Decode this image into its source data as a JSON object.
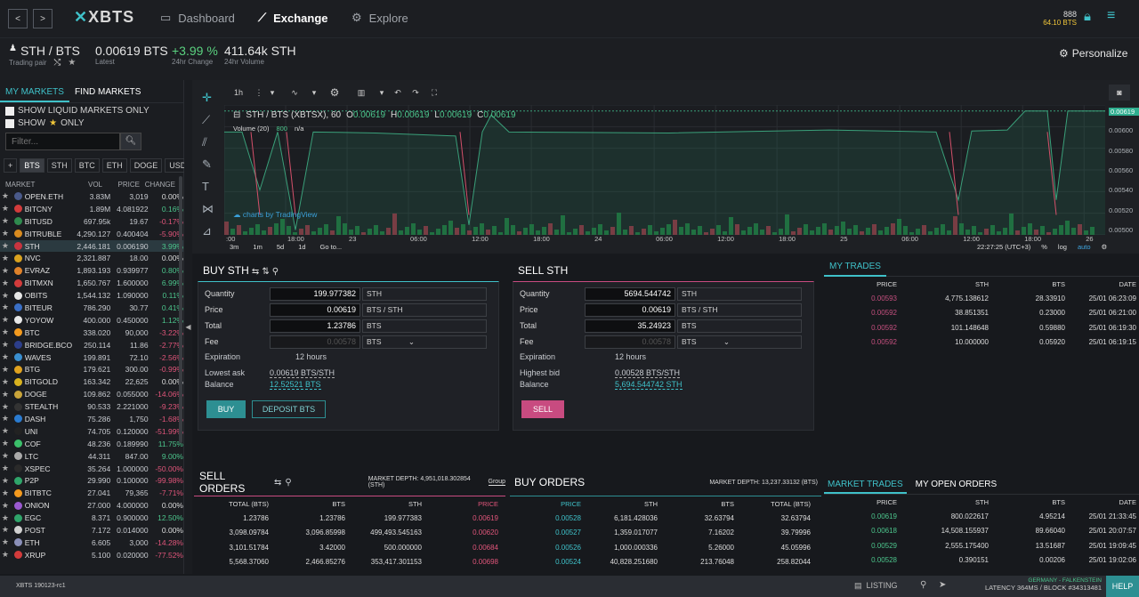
{
  "topbar": {
    "back": "<",
    "forward": ">",
    "logo": "XBTS",
    "nav": [
      {
        "label": "Dashboard",
        "icon": "dashboard-icon"
      },
      {
        "label": "Exchange",
        "icon": "exchange-icon"
      },
      {
        "label": "Explore",
        "icon": "explore-icon"
      }
    ],
    "account_number": "888",
    "account_balance": "64.10 BTS"
  },
  "pairbar": {
    "pair": "STH / BTS",
    "pair_sub": "Trading pair",
    "latest": "0.00619 BTS",
    "latest_sub": "Latest",
    "change": "+3.99 %",
    "change_sub": "24hr Change",
    "volume": "411.64k STH",
    "volume_sub": "24hr Volume",
    "personalize": "Personalize"
  },
  "markets": {
    "tabs": [
      "MY MARKETS",
      "FIND MARKETS"
    ],
    "liquid_label": "SHOW LIQUID MARKETS ONLY",
    "show_label": "SHOW",
    "only_label": "ONLY",
    "filter_placeholder": "Filter...",
    "currency_tabs": [
      "+",
      "BTS",
      "STH",
      "BTC",
      "ETH",
      "DOGE",
      "USD"
    ],
    "columns": [
      "MARKET",
      "VOL",
      "PRICE",
      "CHANGE"
    ],
    "rows": [
      {
        "name": "OPEN.ETH",
        "vol": "3.83M",
        "price": "3,019",
        "change": "0.00%",
        "c": "neu",
        "ic": "#4a5a8a"
      },
      {
        "name": "BITCNY",
        "vol": "1.89M",
        "price": "4.081922",
        "change": "0.16%",
        "c": "pos",
        "ic": "#d23b3b"
      },
      {
        "name": "BITUSD",
        "vol": "697.95k",
        "price": "19.67",
        "change": "-0.17%",
        "c": "neg",
        "ic": "#2f8a4e"
      },
      {
        "name": "BITRUBLE",
        "vol": "4,290.127",
        "price": "0.400404",
        "change": "-5.90%",
        "c": "neg",
        "ic": "#d98b1f"
      },
      {
        "name": "STH",
        "vol": "2,446.181",
        "price": "0.006190",
        "change": "3.99%",
        "c": "pos",
        "ic": "#c8343f"
      },
      {
        "name": "NVC",
        "vol": "2,321.887",
        "price": "18.00",
        "change": "0.00%",
        "c": "neu",
        "ic": "#d9a21f"
      },
      {
        "name": "EVRAZ",
        "vol": "1,893.193",
        "price": "0.939977",
        "change": "0.80%",
        "c": "pos",
        "ic": "#e0822a"
      },
      {
        "name": "BITMXN",
        "vol": "1,650.767",
        "price": "1.600000",
        "change": "6.99%",
        "c": "pos",
        "ic": "#d23b3b"
      },
      {
        "name": "OBITS",
        "vol": "1,544.132",
        "price": "1.090000",
        "change": "0.11%",
        "c": "pos",
        "ic": "#e6e6e6"
      },
      {
        "name": "BITEUR",
        "vol": "786.290",
        "price": "30.77",
        "change": "0.41%",
        "c": "pos",
        "ic": "#3a6fc6"
      },
      {
        "name": "YOYOW",
        "vol": "400.000",
        "price": "0.450000",
        "change": "1.12%",
        "c": "pos",
        "ic": "#e8e8e8"
      },
      {
        "name": "BTC",
        "vol": "338.020",
        "price": "90,000",
        "change": "-3.22%",
        "c": "neg",
        "ic": "#f39a1e"
      },
      {
        "name": "BRIDGE.BCO",
        "vol": "250.114",
        "price": "11.86",
        "change": "-2.77%",
        "c": "neg",
        "ic": "#2c3e8a"
      },
      {
        "name": "WAVES",
        "vol": "199.891",
        "price": "72.10",
        "change": "-2.56%",
        "c": "neg",
        "ic": "#3a8fd0"
      },
      {
        "name": "BTG",
        "vol": "179.621",
        "price": "300.00",
        "change": "-0.99%",
        "c": "neg",
        "ic": "#e0a21f"
      },
      {
        "name": "BITGOLD",
        "vol": "163.342",
        "price": "22,625",
        "change": "0.00%",
        "c": "neu",
        "ic": "#d9b21f"
      },
      {
        "name": "DOGE",
        "vol": "109.862",
        "price": "0.055000",
        "change": "-14.06%",
        "c": "neg",
        "ic": "#c9a43a"
      },
      {
        "name": "STEALTH",
        "vol": "90.533",
        "price": "2.221000",
        "change": "-9.23%",
        "c": "neg",
        "ic": "#333"
      },
      {
        "name": "DASH",
        "vol": "75.286",
        "price": "1,750",
        "change": "-1.68%",
        "c": "neg",
        "ic": "#2a7bd0"
      },
      {
        "name": "UNI",
        "vol": "74.705",
        "price": "0.120000",
        "change": "-51.99%",
        "c": "neg",
        "ic": "#222"
      },
      {
        "name": "COF",
        "vol": "48.236",
        "price": "0.189990",
        "change": "11.75%",
        "c": "pos",
        "ic": "#3bbf6a"
      },
      {
        "name": "LTC",
        "vol": "44.311",
        "price": "847.00",
        "change": "9.00%",
        "c": "pos",
        "ic": "#aaaaaa"
      },
      {
        "name": "XSPEC",
        "vol": "35.264",
        "price": "1.000000",
        "change": "-50.00%",
        "c": "neg",
        "ic": "#2a2a2a"
      },
      {
        "name": "P2P",
        "vol": "29.990",
        "price": "0.100000",
        "change": "-99.98%",
        "c": "neg",
        "ic": "#2fa56a"
      },
      {
        "name": "BITBTC",
        "vol": "27.041",
        "price": "79,365",
        "change": "-7.71%",
        "c": "neg",
        "ic": "#f39a1e"
      },
      {
        "name": "ONION",
        "vol": "27.000",
        "price": "4.000000",
        "change": "0.00%",
        "c": "neu",
        "ic": "#9a5ad0"
      },
      {
        "name": "EGC",
        "vol": "8.371",
        "price": "0.900000",
        "change": "12.50%",
        "c": "pos",
        "ic": "#2fa56a"
      },
      {
        "name": "POST",
        "vol": "7.172",
        "price": "0.014000",
        "change": "0.00%",
        "c": "neu",
        "ic": "#d0d0d0"
      },
      {
        "name": "ETH",
        "vol": "6.605",
        "price": "3,000",
        "change": "-14.28%",
        "c": "neg",
        "ic": "#8a8fb8"
      },
      {
        "name": "XRUP",
        "vol": "5.100",
        "price": "0.020000",
        "change": "-77.52%",
        "c": "neg",
        "ic": "#d23b3b"
      }
    ]
  },
  "chart": {
    "toolbar": {
      "interval": "1h"
    },
    "legend": {
      "title": "STH / BTS (XBTSX), 60",
      "O": "0.00619",
      "H": "0.00619",
      "L": "0.00619",
      "C": "0.00619",
      "volume": "Volume (20)",
      "vol_val": "800",
      "vol_na": "n/a"
    },
    "watermark": "charts by TradingView",
    "y_labels": [
      "0.00619",
      "0.00600",
      "0.00580",
      "0.00560",
      "0.00540",
      "0.00520",
      "0.00500"
    ],
    "x_labels": [
      ":00",
      "18:00",
      "23",
      "06:00",
      "12:00",
      "18:00",
      "24",
      "06:00",
      "12:00",
      "18:00",
      "25",
      "06:00",
      "12:00",
      "18:00",
      "26"
    ],
    "ranges": [
      "3m",
      "1m",
      "5d",
      "1d",
      "Go to..."
    ],
    "time": "22:27:25 (UTC+3)",
    "opts": [
      "%",
      "log",
      "auto"
    ]
  },
  "chart_data": {
    "type": "line",
    "title": "STH / BTS (XBTSX), 60",
    "x": [
      ":00",
      "18:00",
      "23",
      "06:00",
      "12:00",
      "18:00",
      "24",
      "06:00",
      "12:00",
      "18:00",
      "25",
      "06:00",
      "12:00",
      "18:00",
      "26"
    ],
    "ylim": [
      0.00495,
      0.00625
    ],
    "series": [
      {
        "values": [
          0.00598,
          0.00598,
          0.00597,
          0.00598,
          0.00597,
          0.0059,
          0.00598,
          0.00598,
          0.00597,
          0.00599,
          0.006,
          0.00599,
          0.006,
          0.00598,
          0.00619
        ]
      }
    ]
  },
  "buy": {
    "title": "BUY STH",
    "qty_label": "Quantity",
    "qty": "199.977382",
    "qty_unit": "STH",
    "price_label": "Price",
    "price": "0.00619",
    "price_unit": "BTS / STH",
    "total_label": "Total",
    "total": "1.23786",
    "total_unit": "BTS",
    "fee_label": "Fee",
    "fee": "0.00578",
    "fee_unit": "BTS",
    "exp_label": "Expiration",
    "exp": "12 hours",
    "ask_label": "Lowest ask",
    "ask": "0.00619 BTS/STH",
    "bal_label": "Balance",
    "bal": "12.52521 BTS",
    "btn": "BUY",
    "dep": "DEPOSIT BTS"
  },
  "sell": {
    "title": "SELL STH",
    "qty_label": "Quantity",
    "qty": "5694.544742",
    "qty_unit": "STH",
    "price_label": "Price",
    "price": "0.00619",
    "price_unit": "BTS / STH",
    "total_label": "Total",
    "total": "35.24923",
    "total_unit": "BTS",
    "fee_label": "Fee",
    "fee": "0.00578",
    "fee_unit": "BTS",
    "exp_label": "Expiration",
    "exp": "12 hours",
    "bid_label": "Highest bid",
    "bid": "0.00528 BTS/STH",
    "bal_label": "Balance",
    "bal": "5,694.544742 STH",
    "btn": "SELL"
  },
  "mytrades": {
    "tab": "MY TRADES",
    "cols": [
      "PRICE",
      "STH",
      "BTS",
      "DATE"
    ],
    "rows": [
      [
        "0.00593",
        "4,775.138612",
        "28.33910",
        "25/01 06:23:09"
      ],
      [
        "0.00592",
        "38.851351",
        "0.23000",
        "25/01 06:21:00"
      ],
      [
        "0.00592",
        "101.148648",
        "0.59880",
        "25/01 06:19:30"
      ],
      [
        "0.00592",
        "10.000000",
        "0.05920",
        "25/01 06:19:15"
      ]
    ]
  },
  "sellorders": {
    "title": "SELL ORDERS",
    "depth": "MARKET DEPTH: 4,951,018.302854 (STH)",
    "group": "Group",
    "cols": [
      "TOTAL (BTS)",
      "BTS",
      "STH",
      "PRICE"
    ],
    "rows": [
      [
        "1.23786",
        "1.23786",
        "199.977383",
        "0.00619"
      ],
      [
        "3,098.09784",
        "3,096.85998",
        "499,493.545163",
        "0.00620"
      ],
      [
        "3,101.51784",
        "3.42000",
        "500.000000",
        "0.00684"
      ],
      [
        "5,568.37060",
        "2,466.85276",
        "353,417.301153",
        "0.00698"
      ]
    ]
  },
  "buyorders": {
    "title": "BUY ORDERS",
    "depth": "MARKET DEPTH: 13,237.33132 (BTS)",
    "cols": [
      "PRICE",
      "STH",
      "BTS",
      "TOTAL (BTS)"
    ],
    "rows": [
      [
        "0.00528",
        "6,181.428036",
        "32.63794",
        "32.63794"
      ],
      [
        "0.00527",
        "1,359.017077",
        "7.16202",
        "39.79996"
      ],
      [
        "0.00526",
        "1,000.000336",
        "5.26000",
        "45.05996"
      ],
      [
        "0.00524",
        "40,828.251680",
        "213.76048",
        "258.82044"
      ]
    ]
  },
  "markettrades": {
    "tab1": "MARKET TRADES",
    "tab2": "MY OPEN ORDERS",
    "cols": [
      "PRICE",
      "STH",
      "BTS",
      "DATE"
    ],
    "rows": [
      [
        "0.00619",
        "800.022617",
        "4.95214",
        "25/01 21:33:45"
      ],
      [
        "0.00618",
        "14,508.155937",
        "89.66040",
        "25/01 20:07:57"
      ],
      [
        "0.00529",
        "2,555.175400",
        "13.51687",
        "25/01 19:09:45"
      ],
      [
        "0.00528",
        "0.390151",
        "0.00206",
        "25/01 19:02:06"
      ]
    ]
  },
  "footer": {
    "version": "XBTS 190123-rc1",
    "listing": "LISTING",
    "server": "GERMANY - FALKENSTEIN",
    "latency": "LATENCY 364MS / BLOCK #34313481",
    "help": "HELP"
  }
}
